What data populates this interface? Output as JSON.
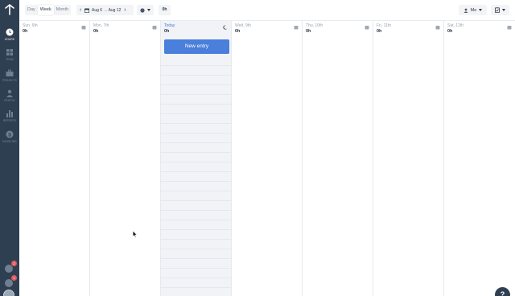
{
  "sidebar": {
    "items": [
      {
        "label": "HOURS",
        "icon": "clock-icon",
        "active": true
      },
      {
        "label": "TEAM",
        "icon": "team-icon",
        "active": false
      },
      {
        "label": "PROJECTS",
        "icon": "briefcase-icon",
        "active": false
      },
      {
        "label": "PEOPLE",
        "icon": "person-icon",
        "active": false
      },
      {
        "label": "REPORTS",
        "icon": "bar-chart-icon",
        "active": false
      },
      {
        "label": "INVOICING",
        "icon": "dollar-icon",
        "active": false
      }
    ],
    "notifications_badge": "2",
    "alerts_badge": "1"
  },
  "toolbar": {
    "views": [
      "Day",
      "Week",
      "Month"
    ],
    "active_view": "Week",
    "date_range": "Aug 6 → Aug 12",
    "total_hours": "0h",
    "user_filter": "Me"
  },
  "days": [
    {
      "name": "Sun, 6th",
      "hours": "0h",
      "today": false
    },
    {
      "name": "Mon, 7th",
      "hours": "0h",
      "today": false
    },
    {
      "name": "Today",
      "hours": "0h",
      "today": true
    },
    {
      "name": "Wed, 9th",
      "hours": "0h",
      "today": false
    },
    {
      "name": "Thu, 10th",
      "hours": "0h",
      "today": false
    },
    {
      "name": "Fri, 11th",
      "hours": "0h",
      "today": false
    },
    {
      "name": "Sat, 12th",
      "hours": "0h",
      "today": false
    }
  ],
  "new_entry_label": "New entry",
  "help_label": "?",
  "colors": {
    "sidebar": "#2f3f52",
    "accent": "#4a7fdb",
    "today_bg": "#f1f3f7"
  }
}
